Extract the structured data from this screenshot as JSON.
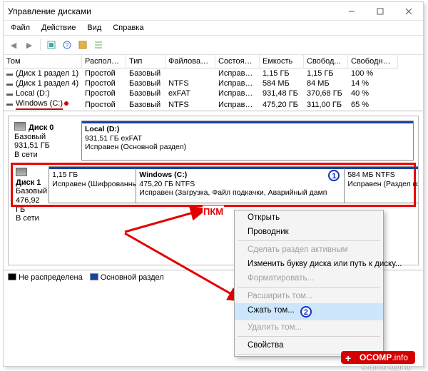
{
  "window": {
    "title": "Управление дисками",
    "menu": [
      "Файл",
      "Действие",
      "Вид",
      "Справка"
    ]
  },
  "columns": [
    "Том",
    "Располож...",
    "Тип",
    "Файловая с...",
    "Состояние",
    "Емкость",
    "Свобод...",
    "Свободно %"
  ],
  "volumes": [
    {
      "name": "(Диск 1 раздел 1)",
      "layout": "Простой",
      "type": "Базовый",
      "fs": "",
      "status": "Исправен...",
      "capacity": "1,15 ГБ",
      "free": "1,15 ГБ",
      "pct": "100 %"
    },
    {
      "name": "(Диск 1 раздел 4)",
      "layout": "Простой",
      "type": "Базовый",
      "fs": "NTFS",
      "status": "Исправен...",
      "capacity": "584 МБ",
      "free": "84 МБ",
      "pct": "14 %"
    },
    {
      "name": "Local (D:)",
      "layout": "Простой",
      "type": "Базовый",
      "fs": "exFAT",
      "status": "Исправен...",
      "capacity": "931,48 ГБ",
      "free": "370,68 ГБ",
      "pct": "40 %"
    },
    {
      "name": "Windows (C:)",
      "layout": "Простой",
      "type": "Базовый",
      "fs": "NTFS",
      "status": "Исправен...",
      "capacity": "475,20 ГБ",
      "free": "311,00 ГБ",
      "pct": "65 %",
      "highlight": true
    }
  ],
  "disks": [
    {
      "name": "Диск 0",
      "info1": "Базовый",
      "info2": "931,51 ГБ",
      "info3": "В сети",
      "parts": [
        {
          "title": "Local  (D:)",
          "line2": "931,51 ГБ exFAT",
          "line3": "Исправен (Основной раздел)",
          "w": "100%"
        }
      ]
    },
    {
      "name": "Диск 1",
      "info1": "Базовый",
      "info2": "476,92 ГБ",
      "info3": "В сети",
      "highlight": true,
      "parts": [
        {
          "title": "",
          "line2": "1,15 ГБ",
          "line3": "Исправен (Шифрованный",
          "w": "23%"
        },
        {
          "title": "Windows  (C:)",
          "line2": "475,20 ГБ NTFS",
          "line3": "Исправен (Загрузка, Файл подкачки, Аварийный дамп",
          "w": "55%",
          "step": 1
        },
        {
          "title": "",
          "line2": "584 МБ NTFS",
          "line3": "Исправен (Раздел изгот",
          "w": "22%"
        }
      ]
    }
  ],
  "context_menu": [
    {
      "label": "Открыть",
      "enabled": true
    },
    {
      "label": "Проводник",
      "enabled": true
    },
    {
      "sep": true
    },
    {
      "label": "Сделать раздел активным",
      "enabled": false
    },
    {
      "label": "Изменить букву диска или путь к диску...",
      "enabled": true
    },
    {
      "label": "Форматировать...",
      "enabled": false
    },
    {
      "sep": true
    },
    {
      "label": "Расширить том...",
      "enabled": false
    },
    {
      "label": "Сжать том...",
      "enabled": true,
      "highlight": true,
      "step": 2
    },
    {
      "label": "Удалить том...",
      "enabled": false
    },
    {
      "sep": true
    },
    {
      "label": "Свойства",
      "enabled": true
    },
    {
      "sep": true
    }
  ],
  "annotation": {
    "pkm": "ПКМ"
  },
  "legend": {
    "unallocated": "Не распределена",
    "primary": "Основной раздел"
  },
  "watermark": {
    "brand": "OCOMP",
    "tld": ".info",
    "sub": "вопросы админу"
  }
}
